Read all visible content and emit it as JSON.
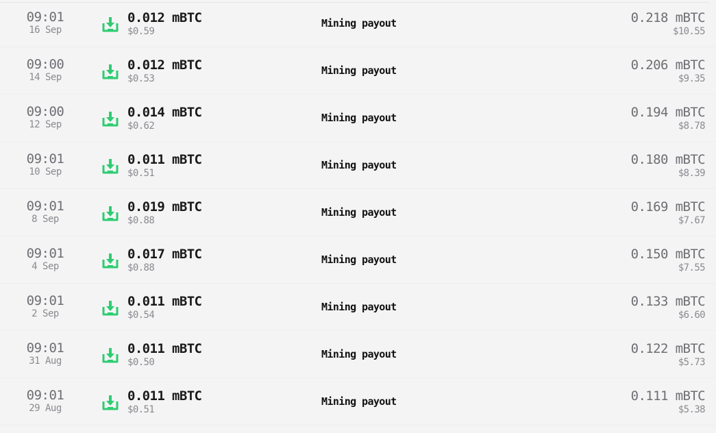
{
  "theme": {
    "accent_green": "#2ecc71"
  },
  "transactions": [
    {
      "time": "09:01",
      "date": "16 Sep",
      "icon": "download-icon",
      "amount": "0.012 mBTC",
      "amount_usd": "$0.59",
      "description": "Mining payout",
      "balance": "0.218 mBTC",
      "balance_usd": "$10.55"
    },
    {
      "time": "09:00",
      "date": "14 Sep",
      "icon": "download-icon",
      "amount": "0.012 mBTC",
      "amount_usd": "$0.53",
      "description": "Mining payout",
      "balance": "0.206 mBTC",
      "balance_usd": "$9.35"
    },
    {
      "time": "09:00",
      "date": "12 Sep",
      "icon": "download-icon",
      "amount": "0.014 mBTC",
      "amount_usd": "$0.62",
      "description": "Mining payout",
      "balance": "0.194 mBTC",
      "balance_usd": "$8.78"
    },
    {
      "time": "09:01",
      "date": "10 Sep",
      "icon": "download-icon",
      "amount": "0.011 mBTC",
      "amount_usd": "$0.51",
      "description": "Mining payout",
      "balance": "0.180 mBTC",
      "balance_usd": "$8.39"
    },
    {
      "time": "09:01",
      "date": "8 Sep",
      "icon": "download-icon",
      "amount": "0.019 mBTC",
      "amount_usd": "$0.88",
      "description": "Mining payout",
      "balance": "0.169 mBTC",
      "balance_usd": "$7.67"
    },
    {
      "time": "09:01",
      "date": "4 Sep",
      "icon": "download-icon",
      "amount": "0.017 mBTC",
      "amount_usd": "$0.88",
      "description": "Mining payout",
      "balance": "0.150 mBTC",
      "balance_usd": "$7.55"
    },
    {
      "time": "09:01",
      "date": "2 Sep",
      "icon": "download-icon",
      "amount": "0.011 mBTC",
      "amount_usd": "$0.54",
      "description": "Mining payout",
      "balance": "0.133 mBTC",
      "balance_usd": "$6.60"
    },
    {
      "time": "09:01",
      "date": "31 Aug",
      "icon": "download-icon",
      "amount": "0.011 mBTC",
      "amount_usd": "$0.50",
      "description": "Mining payout",
      "balance": "0.122 mBTC",
      "balance_usd": "$5.73"
    },
    {
      "time": "09:01",
      "date": "29 Aug",
      "icon": "download-icon",
      "amount": "0.011 mBTC",
      "amount_usd": "$0.51",
      "description": "Mining payout",
      "balance": "0.111 mBTC",
      "balance_usd": "$5.38"
    }
  ]
}
